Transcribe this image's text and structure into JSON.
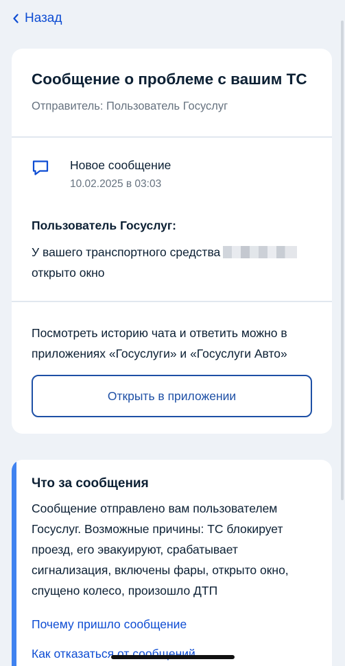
{
  "nav": {
    "back_label": "Назад"
  },
  "message_card": {
    "title": "Сообщение о проблеме с вашим ТС",
    "sender": "Отправитель: Пользователь Госуслуг",
    "status": "Новое сообщение",
    "datetime": "10.02.2025 в 03:03",
    "author": "Пользователь Госуслуг:",
    "text_before": "У вашего транспортного средства",
    "text_after": "открыто окно",
    "app_hint": "Посмотреть историю чата и ответить можно в приложениях «Госуслуги» и «Госуслуги Авто»",
    "open_button_label": "Открыть в приложении"
  },
  "info_card": {
    "title": "Что за сообщения",
    "text": "Сообщение отправлено вам пользователем Госуслуг. Возможные причины: ТС блокирует проезд, его эвакуируют, срабатывает сигнализация, включены фары, открыто окно, спущено колесо, произошло ДТП",
    "link_why": "Почему пришло сообщение",
    "link_unsubscribe": "Как отказаться от сообщений"
  },
  "colors": {
    "background": "#eef2f7",
    "link": "#0d4cd3",
    "button_border": "#1d4fa5",
    "accent_bar": "#3f82f0",
    "secondary_text": "#66727f"
  },
  "icons": {
    "back": "chevron-left-icon",
    "message": "chat-bubble-icon"
  }
}
